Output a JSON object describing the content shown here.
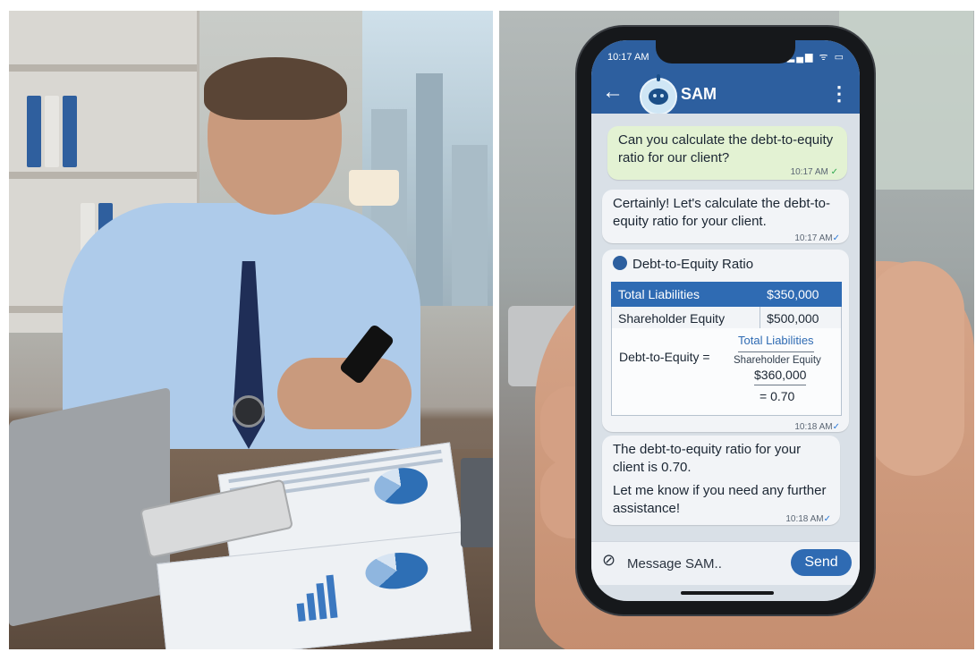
{
  "status_bar": {
    "time": "10:17 AM",
    "icons": "▂▄▆ ᯤ ▭"
  },
  "header": {
    "back_icon": "←",
    "title": "SAM",
    "menu_icon": "⋮"
  },
  "messages": [
    {
      "sender": "user",
      "text": "Can you calculate the debt-to-equity ratio for our client?",
      "time": "10:17 AM",
      "status": "✓"
    },
    {
      "sender": "bot",
      "text": "Certainly! Let's calculate the debt-to-equity ratio for your client.",
      "time": "10:17 AM",
      "status": "✓"
    },
    {
      "sender": "bot",
      "card": {
        "title": "Debt-to-Equity Ratio",
        "rows": [
          {
            "label": "Total Liabilities",
            "value": "$350,000",
            "highlight": true
          },
          {
            "label": "Shareholder Equity",
            "value": "$500,000",
            "highlight": false
          }
        ],
        "formula_label": "Debt-to-Equity =",
        "numerator": "Total Liabilities",
        "denominator": "Shareholder Equity",
        "computed_value": "$360,000",
        "result": "= 0.70"
      },
      "time": "10:18 AM",
      "status": "✓"
    },
    {
      "sender": "bot",
      "text": "The debt-to-equity ratio for your client is 0.70.",
      "text2": "Let me know if you need any further assistance!",
      "time": "10:18 AM",
      "status": "✓"
    }
  ],
  "composer": {
    "placeholder": "Message SAM..",
    "send_label": "Send",
    "attach_icon": "🔗"
  },
  "colors": {
    "header": "#2d5f9f",
    "user_bubble": "#e3f2d3",
    "bot_bubble": "#f2f4f7",
    "accent": "#2f6bb3",
    "chat_bg": "#d9e0e7"
  }
}
